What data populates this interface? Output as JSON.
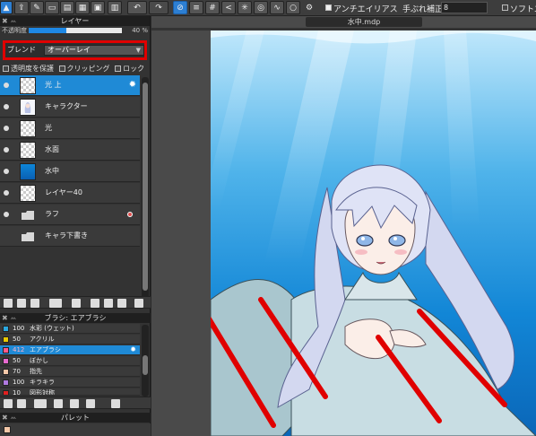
{
  "toolbar": {
    "antialias_label": "アンチエイリアス",
    "stabilizer_label": "手ぶれ補正",
    "stabilizer_value": "8",
    "soft_label": "ソフトエ"
  },
  "layer_panel": {
    "title": "レイヤー",
    "opacity_label": "不透明度",
    "opacity_value": "40 %",
    "opacity_fraction": 0.4,
    "blend_label": "ブレンド",
    "blend_value": "オーバーレイ",
    "protect_alpha_label": "透明度を保護",
    "clipping_label": "クリッピング",
    "lock_label": "ロック",
    "layers": [
      {
        "name": "光 上",
        "selected": true
      },
      {
        "name": "キャラクター"
      },
      {
        "name": "光"
      },
      {
        "name": "水面"
      },
      {
        "name": "水中"
      },
      {
        "name": "レイヤー40"
      },
      {
        "name": "ラフ"
      },
      {
        "name": "キャラ下書き"
      }
    ]
  },
  "brush_panel": {
    "title": "ブラシ: エアブラシ",
    "brushes": [
      {
        "size": "100",
        "name": "水彩 (ウェット)",
        "color": "#2aa8e0"
      },
      {
        "size": "50",
        "name": "アクリル",
        "color": "#e8c800"
      },
      {
        "size": "412",
        "name": "エアブラシ",
        "color": "#ff5a8a",
        "selected": true
      },
      {
        "size": "50",
        "name": "ぼかし",
        "color": "#e86ad0"
      },
      {
        "size": "70",
        "name": "指先",
        "color": "#f4c8a8"
      },
      {
        "size": "100",
        "name": "キラキラ",
        "color": "#b07ae0"
      },
      {
        "size": "10",
        "name": "図形対称",
        "color": "#e02020"
      }
    ]
  },
  "palette_panel": {
    "title": "パレット"
  },
  "canvas": {
    "file_name": "水中.mdp"
  }
}
